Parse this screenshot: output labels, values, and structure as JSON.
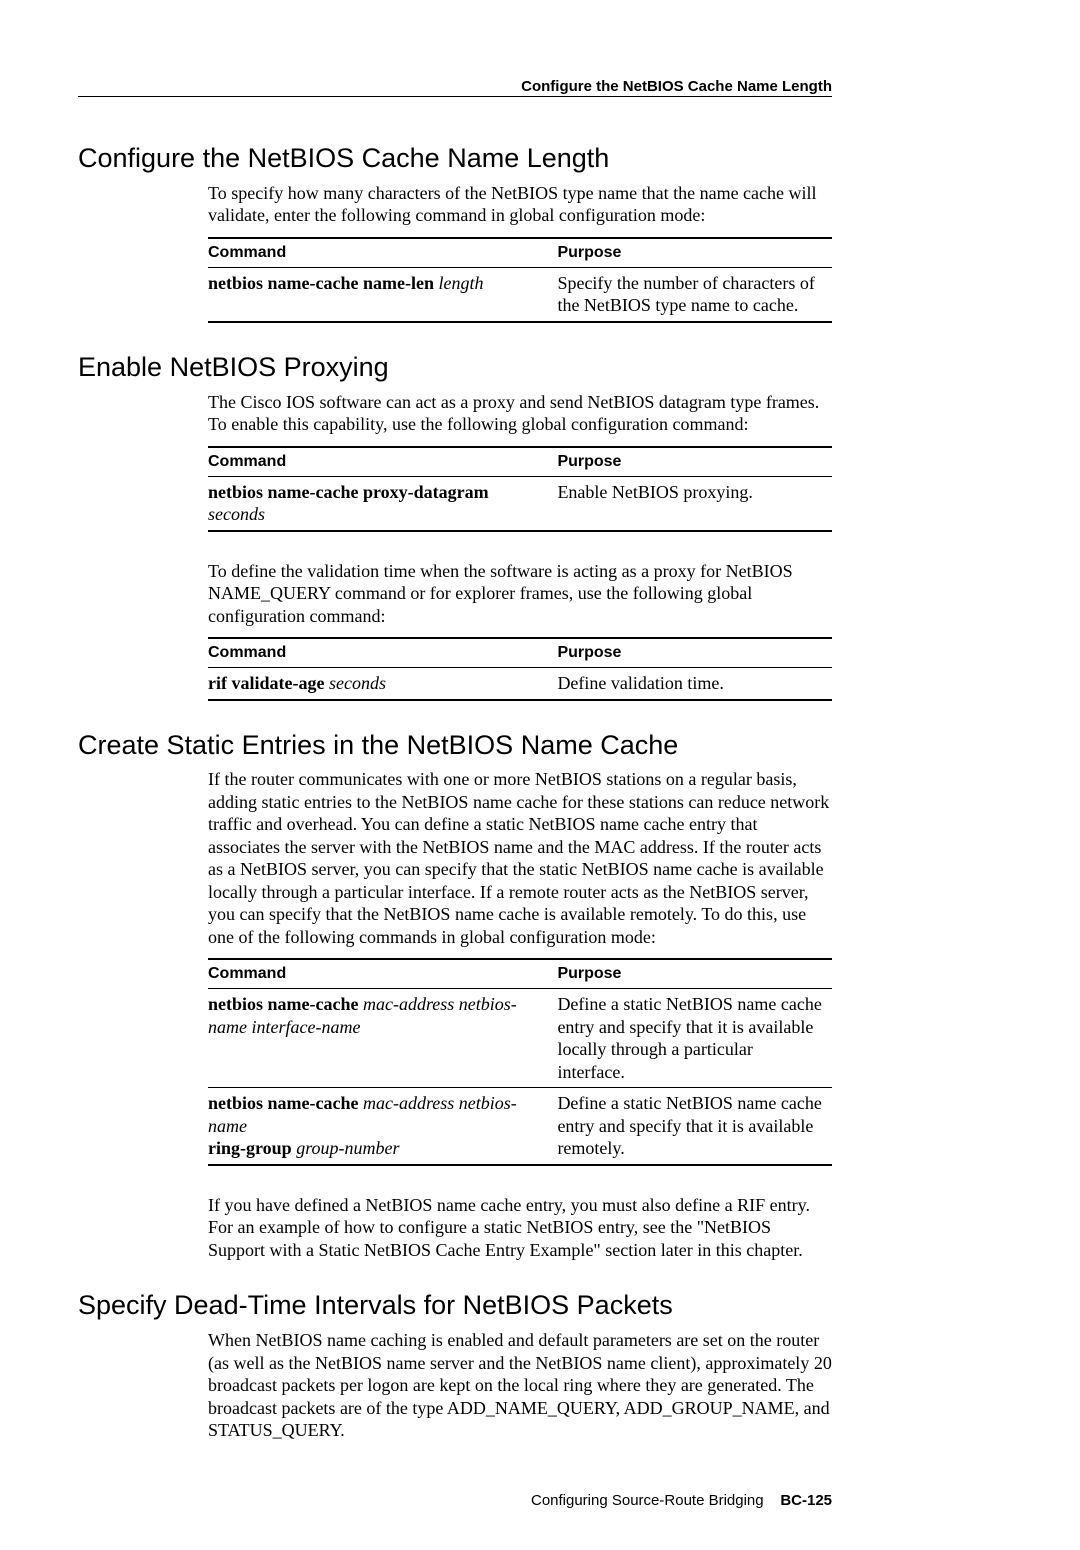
{
  "running_head": "Configure the NetBIOS Cache Name Length",
  "sections": {
    "s1": {
      "title": "Configure the NetBIOS Cache Name Length",
      "p1": "To specify how many characters of the NetBIOS type name that the name cache will validate, enter the following command in global configuration mode:",
      "tbl": {
        "h_cmd": "Command",
        "h_purp": "Purpose",
        "r1_c1a": "netbios name-cache name-len",
        "r1_c1b": "length",
        "r1_purp": "Specify the number of characters of the NetBIOS type name to cache."
      }
    },
    "s2": {
      "title": "Enable NetBIOS Proxying",
      "p1": "The Cisco IOS software can act as a proxy and send NetBIOS datagram type frames. To enable this capability, use the following global configuration command:",
      "tbl1": {
        "h_cmd": "Command",
        "h_purp": "Purpose",
        "r1_c1a": "netbios name-cache proxy-datagram",
        "r1_c1b": "seconds",
        "r1_purp": "Enable NetBIOS proxying."
      },
      "p2": "To define the validation time when the software is acting as a proxy for NetBIOS NAME_QUERY command or for explorer frames, use the following global configuration command:",
      "tbl2": {
        "h_cmd": "Command",
        "h_purp": "Purpose",
        "r1_c1a": "rif validate-age",
        "r1_c1b": "seconds",
        "r1_purp": "Define validation time."
      }
    },
    "s3": {
      "title": "Create Static Entries in the NetBIOS Name Cache",
      "p1": "If the router communicates with one or more NetBIOS stations on a regular basis, adding static entries to the NetBIOS name cache for these stations can reduce network traffic and overhead. You can define a static NetBIOS name cache entry that associates the server with the NetBIOS name and the MAC address. If the router acts as a NetBIOS server, you can specify that the static NetBIOS name cache is available locally through a particular interface. If a remote router acts as the NetBIOS server, you can specify that the NetBIOS name cache is available remotely. To do this, use one of the following commands in global configuration mode:",
      "tbl": {
        "h_cmd": "Command",
        "h_purp": "Purpose",
        "r1_c1a": "netbios name-cache",
        "r1_c1b": "mac-address netbios-name interface-name",
        "r1_purp": "Define a static NetBIOS name cache entry and specify that it is available locally through a particular interface.",
        "r2_c1a": "netbios name-cache",
        "r2_c1b": "mac-address netbios-name",
        "r2_c1c": "ring-group",
        "r2_c1d": "group-number",
        "r2_purp": "Define a static NetBIOS name cache entry and specify that it is available remotely."
      },
      "p2": "If you have defined a NetBIOS name cache entry, you must also define a RIF entry. For an example of how to configure a static NetBIOS entry, see the \"NetBIOS Support with a Static NetBIOS Cache Entry Example\" section later in this chapter."
    },
    "s4": {
      "title": "Specify Dead-Time Intervals for NetBIOS Packets",
      "p1": "When NetBIOS name caching is enabled and default parameters are set on the router (as well as the NetBIOS name server and the NetBIOS name client), approximately 20 broadcast packets per logon are kept on the local ring where they are generated. The broadcast packets are of the type ADD_NAME_QUERY, ADD_GROUP_NAME, and STATUS_QUERY."
    }
  },
  "footer": {
    "text": "Configuring Source-Route Bridging",
    "page": "BC-125"
  }
}
